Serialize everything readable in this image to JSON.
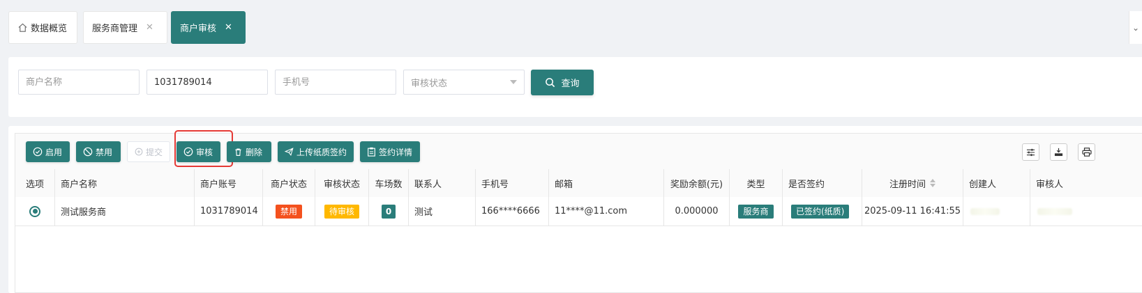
{
  "tabs": [
    {
      "label": "数据概览",
      "icon": "home-icon",
      "closable": false,
      "active": false
    },
    {
      "label": "服务商管理",
      "closable": true,
      "active": false
    },
    {
      "label": "商户审核",
      "closable": true,
      "active": true
    }
  ],
  "tab_more_icon": "chevron-down-icon",
  "search": {
    "merchant_name_placeholder": "商户名称",
    "account_value": "1031789014",
    "phone_placeholder": "手机号",
    "status_placeholder": "审核状态",
    "query_label": "查询"
  },
  "toolbar": {
    "enable": "启用",
    "disable": "禁用",
    "submit": "提交",
    "review": "审核",
    "delete": "删除",
    "upload": "上传纸质签约",
    "sign_detail": "签约详情"
  },
  "table": {
    "headers": [
      "选项",
      "商户名称",
      "商户账号",
      "商户状态",
      "审核状态",
      "车场数",
      "联系人",
      "手机号",
      "邮箱",
      "奖励余额(元)",
      "类型",
      "是否签约",
      "注册时间",
      "创建人",
      "审核人"
    ],
    "rows": [
      {
        "name": "测试服务商",
        "account": "1031789014",
        "merchant_status": "禁用",
        "review_status": "待审核",
        "parking_count": "0",
        "contact": "测试",
        "phone": "166****6666",
        "email": "11****@11.com",
        "balance": "0.000000",
        "type": "服务商",
        "signed": "已签约(纸质)",
        "reg_time": "2025-09-11 16:41:55",
        "creator": "‌",
        "reviewer": "‌"
      }
    ]
  },
  "colors": {
    "primary": "#2a7d7a",
    "danger": "#f4511e",
    "warning": "#ffb800",
    "highlight": "#e53935"
  }
}
